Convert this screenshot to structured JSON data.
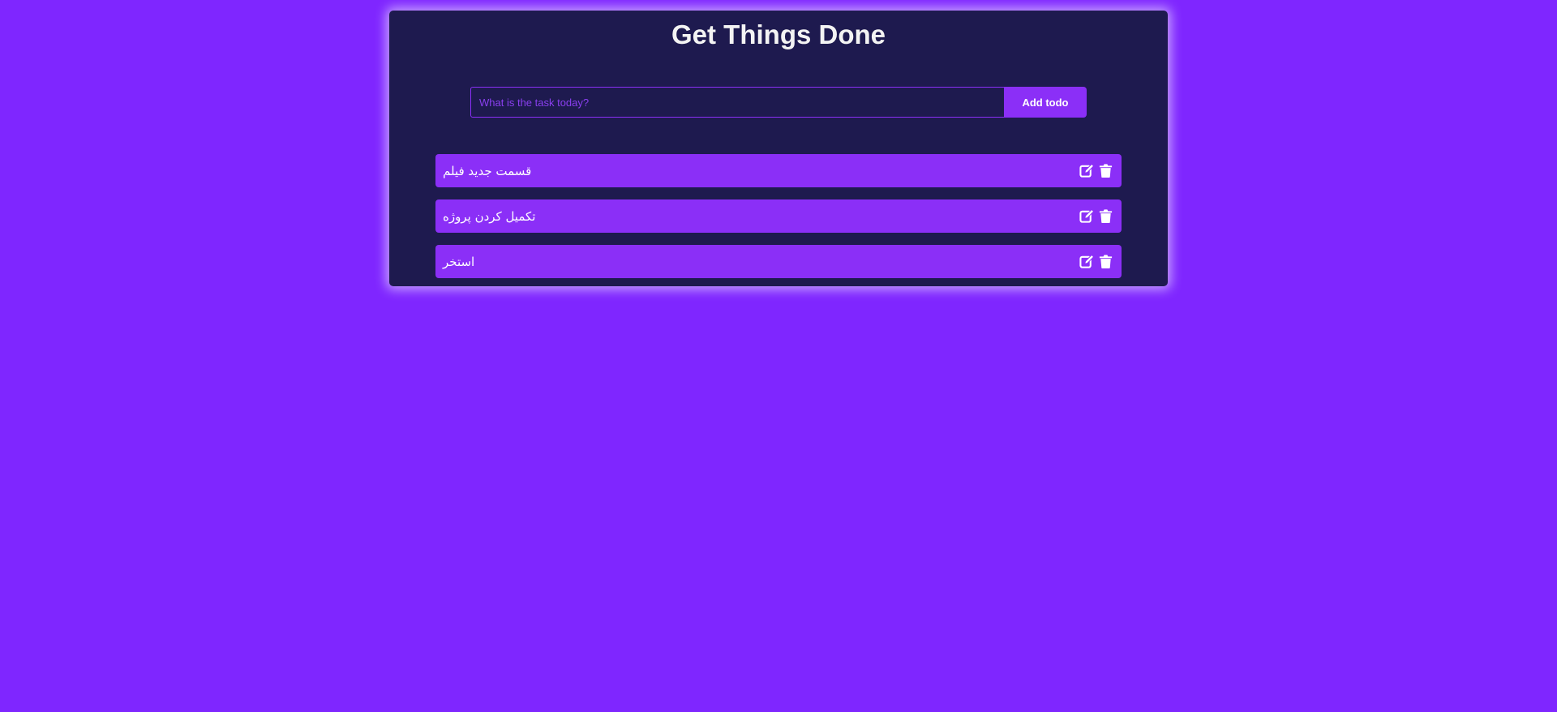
{
  "app": {
    "title": "Get Things Done"
  },
  "form": {
    "placeholder": "What is the task today?",
    "value": "",
    "add_label": "Add todo"
  },
  "todos": [
    {
      "text": "قسمت جدید فیلم",
      "edit_icon": "edit-icon",
      "delete_icon": "trash-icon"
    },
    {
      "text": "تکمیل کردن پروژه",
      "edit_icon": "edit-icon",
      "delete_icon": "trash-icon"
    },
    {
      "text": "استخر",
      "edit_icon": "edit-icon",
      "delete_icon": "trash-icon"
    }
  ],
  "colors": {
    "background": "#7f26ff",
    "card": "#1e1a4f",
    "accent": "#8b2ff7",
    "text": "#ffffff"
  }
}
